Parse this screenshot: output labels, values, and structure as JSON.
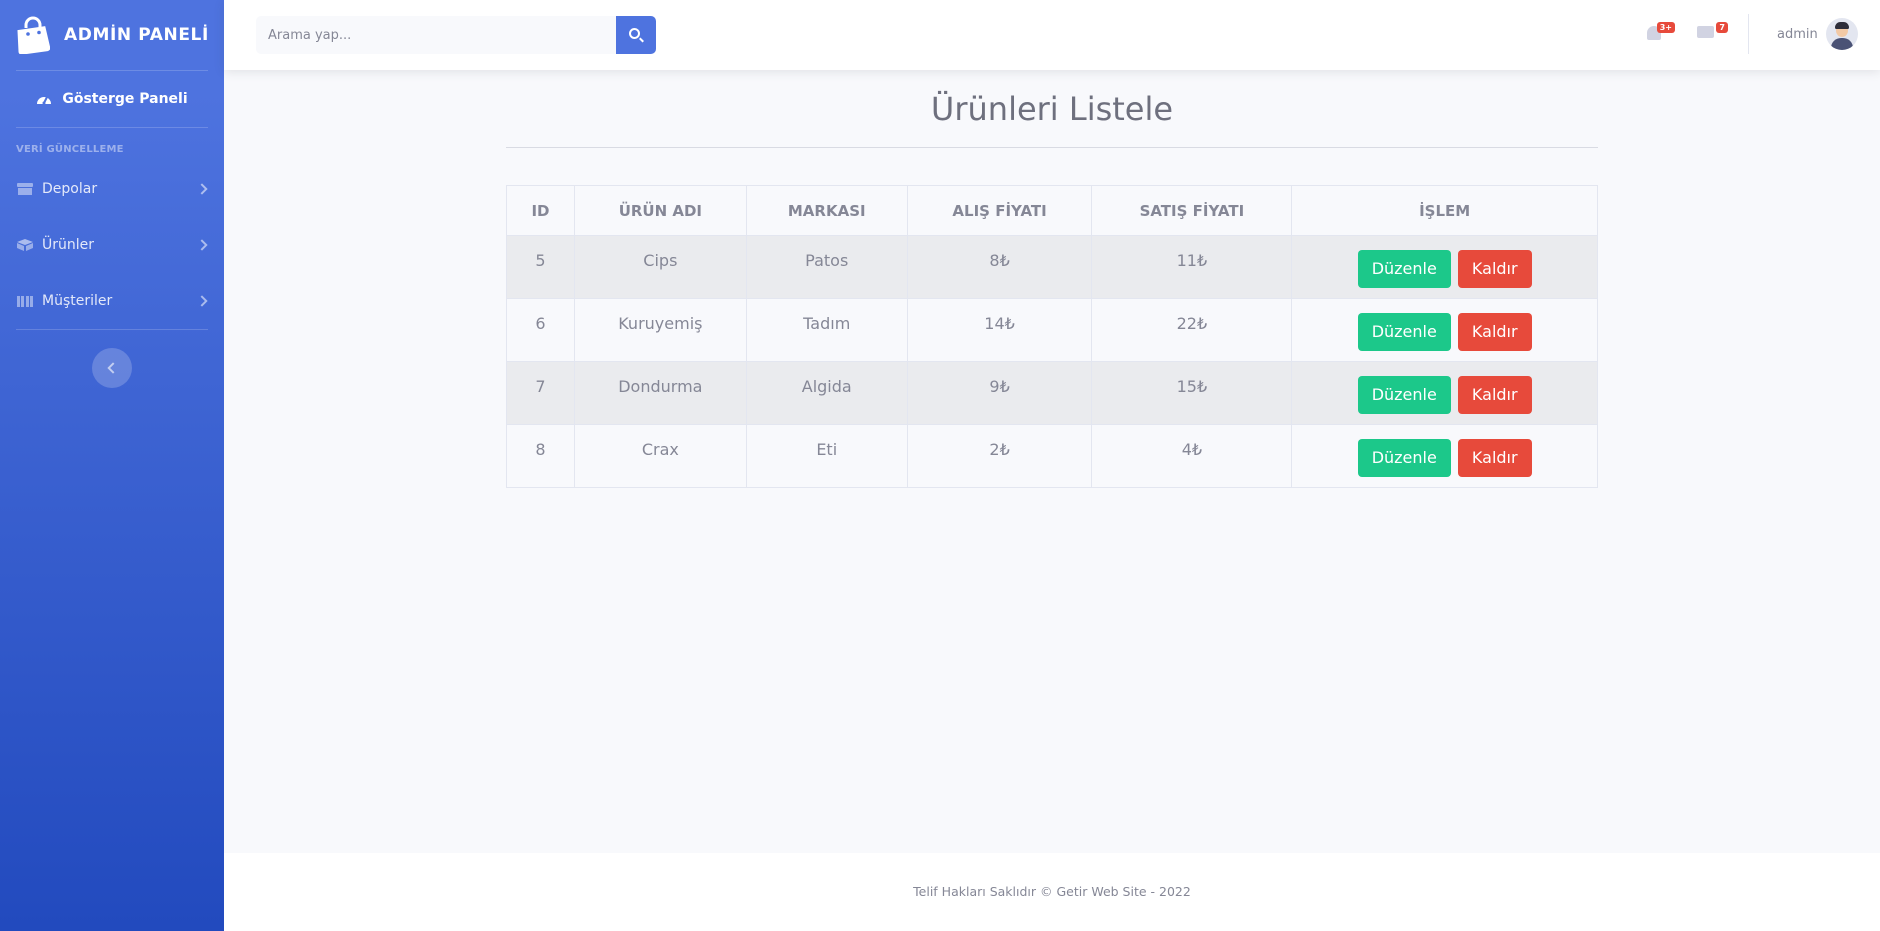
{
  "brand": {
    "title": "ADMİN PANELİ",
    "icon": "shopping-bag-icon"
  },
  "sidebar": {
    "dashboard_label": "Gösterge Paneli",
    "heading": "VERİ GÜNCELLEME",
    "items": [
      {
        "label": "Depolar",
        "icon": "store-icon"
      },
      {
        "label": "Ürünler",
        "icon": "box-icon"
      },
      {
        "label": "Müşteriler",
        "icon": "users-icon"
      }
    ]
  },
  "topbar": {
    "search_placeholder": "Arama yap...",
    "alerts_count": "3+",
    "messages_count": "7",
    "username": "admin"
  },
  "page": {
    "title": "Ürünleri Listele"
  },
  "table": {
    "headers": [
      "ID",
      "ÜRÜN ADI",
      "MARKASI",
      "ALIŞ FİYATI",
      "SATIŞ FİYATI",
      "İŞLEM"
    ],
    "edit_label": "Düzenle",
    "delete_label": "Kaldır",
    "rows": [
      {
        "id": "5",
        "name": "Cips",
        "brand": "Patos",
        "buy": "8₺",
        "sell": "11₺"
      },
      {
        "id": "6",
        "name": "Kuruyemiş",
        "brand": "Tadım",
        "buy": "14₺",
        "sell": "22₺"
      },
      {
        "id": "7",
        "name": "Dondurma",
        "brand": "Algida",
        "buy": "9₺",
        "sell": "15₺"
      },
      {
        "id": "8",
        "name": "Crax",
        "brand": "Eti",
        "buy": "2₺",
        "sell": "4₺"
      }
    ]
  },
  "footer": {
    "text": "Telif Hakları Saklıdır © Getir Web Site - 2022"
  },
  "colors": {
    "primary": "#4e73df",
    "success": "#1cc88a",
    "danger": "#e74a3b"
  }
}
